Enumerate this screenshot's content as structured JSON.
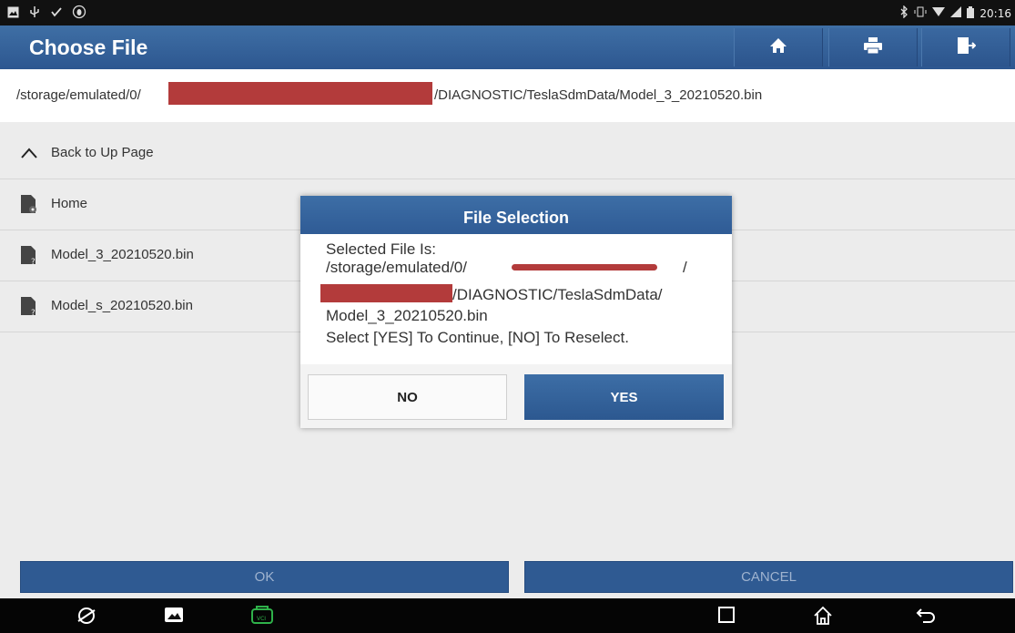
{
  "status_bar": {
    "time": "20:16",
    "left_icons": [
      "image-icon",
      "usb-icon",
      "check-icon",
      "bug-icon"
    ],
    "right_icons": [
      "bluetooth-icon",
      "vibrate-icon",
      "wifi-icon",
      "signal-icon",
      "battery-icon"
    ]
  },
  "header": {
    "title": "Choose File",
    "buttons": [
      "home-icon",
      "print-icon",
      "exit-icon"
    ]
  },
  "path": {
    "prefix": "/storage/emulated/0/",
    "suffix": "/DIAGNOSTIC/TeslaSdmData/Model_3_20210520.bin"
  },
  "list": {
    "back_label": "Back to Up Page",
    "items": [
      {
        "label": "Home",
        "icon": "folder-file-icon"
      },
      {
        "label": "Model_3_20210520.bin",
        "icon": "unknown-file-icon"
      },
      {
        "label": "Model_s_20210520.bin",
        "icon": "unknown-file-icon"
      }
    ]
  },
  "bottom": {
    "ok_label": "OK",
    "cancel_label": "CANCEL"
  },
  "dialog": {
    "title": "File Selection",
    "line1": "Selected File Is:",
    "line2": "/storage/emulated/0/",
    "line2_end": "/",
    "line3": "/DIAGNOSTIC/TeslaSdmData/",
    "line4": "Model_3_20210520.bin",
    "line5": "Select [YES] To Continue, [NO] To Reselect.",
    "no_label": "NO",
    "yes_label": "YES"
  },
  "colors": {
    "header": "#2d5790",
    "redaction": "#b33b3b",
    "background": "#ececec"
  }
}
